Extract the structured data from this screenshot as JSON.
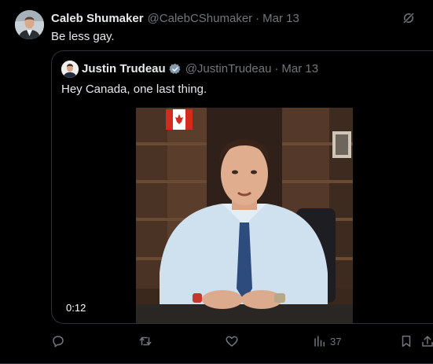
{
  "author": {
    "name": "Caleb Shumaker",
    "handle": "@CalebCShumaker",
    "separator": "·",
    "date": "Mar 13",
    "text": "Be less gay."
  },
  "quoted": {
    "name": "Justin Trudeau",
    "handle": "@JustinTrudeau",
    "separator": "·",
    "date": "Mar 13",
    "text": "Hey Canada, one last thing.",
    "video_duration": "0:12",
    "verified_icon": "verified-badge-icon"
  },
  "actions": {
    "reply_icon": "reply-icon",
    "retweet_icon": "retweet-icon",
    "like_icon": "like-icon",
    "views_icon": "views-icon",
    "views_count": "37",
    "bookmark_icon": "bookmark-icon",
    "share_icon": "share-icon"
  },
  "colors": {
    "background": "#000000",
    "text_primary": "#e7e9ea",
    "text_secondary": "#71767b",
    "border": "#2f3336",
    "verified": "#829aab"
  }
}
